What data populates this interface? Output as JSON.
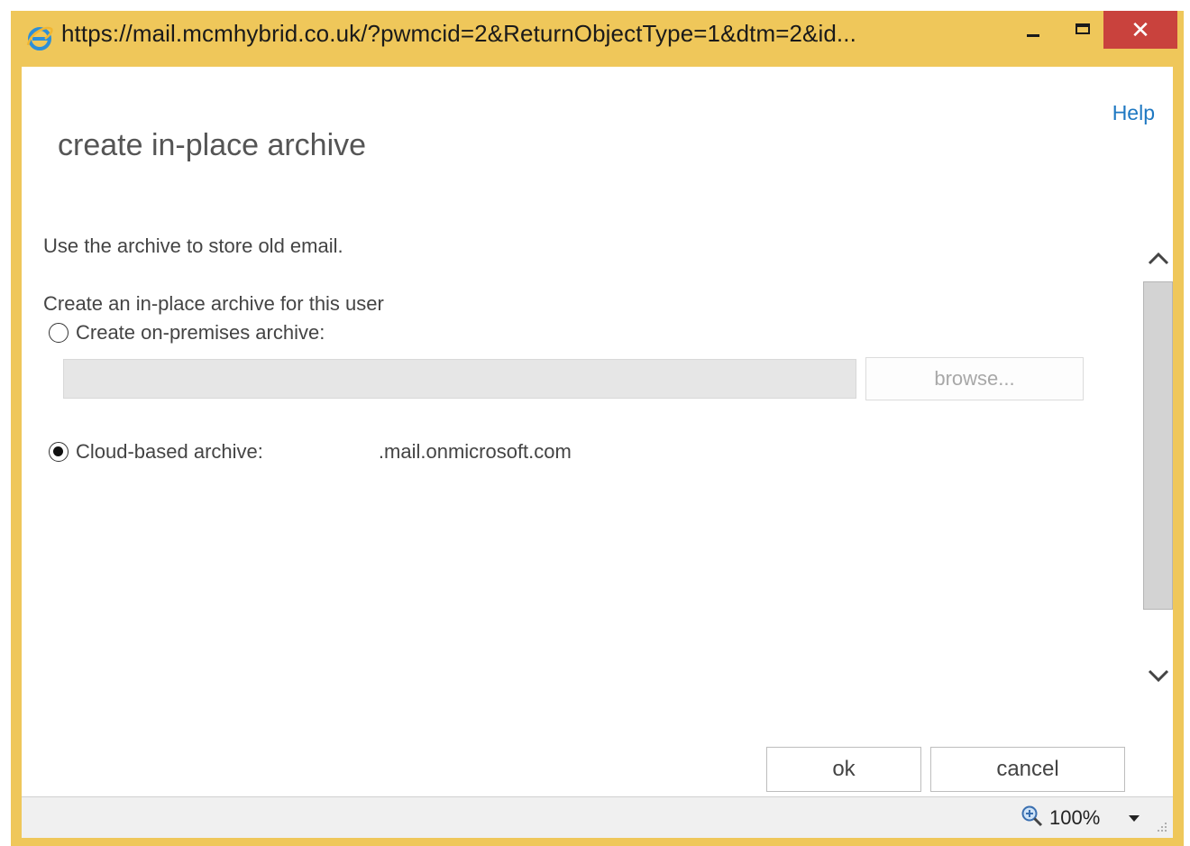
{
  "window": {
    "title": "https://mail.mcmhybrid.co.uk/?pwmcid=2&ReturnObjectType=1&dtm=2&id...",
    "close_glyph": "✕",
    "frame_color": "#efc75a",
    "close_color": "#c9423d"
  },
  "header": {
    "help_label": "Help",
    "title": "create in-place archive"
  },
  "body": {
    "description": "Use the archive to store old email.",
    "section_label": "Create an in-place archive for this user",
    "on_premises_label": "Create on-premises archive:",
    "on_premises_selected": false,
    "on_premises_path_value": "",
    "browse_label": "browse...",
    "cloud_label": "Cloud-based archive:",
    "cloud_selected": true,
    "cloud_domain": ".mail.onmicrosoft.com"
  },
  "footer": {
    "ok_label": "ok",
    "cancel_label": "cancel"
  },
  "statusbar": {
    "zoom_level": "100%"
  },
  "icons": {
    "app": "internet-explorer-icon",
    "zoom": "zoom-magnifier-icon",
    "scroll_up": "chevron-up-icon",
    "scroll_down": "chevron-down-icon"
  }
}
